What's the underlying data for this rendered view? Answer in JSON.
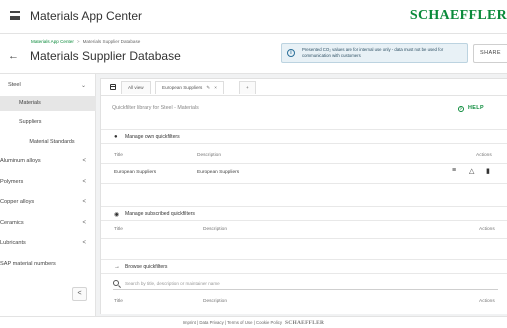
{
  "header": {
    "app_title": "Materials App Center",
    "logo_text": "SCHAEFFLER"
  },
  "subheader": {
    "breadcrumb": [
      "Materials App Center",
      "Materials Supplier Database"
    ],
    "page_title": "Materials Supplier Database",
    "notice": "Presented CO₂ values are for internal use only - data must not be used for communication with customers",
    "share_label": "SHARE"
  },
  "sidebar": {
    "steel": "Steel",
    "steel_sub": [
      "Materials",
      "Suppliers",
      "Material Standards"
    ],
    "groups": [
      "Aluminum alloys",
      "Polymers",
      "Copper alloys",
      "Ceramics",
      "Lubricants"
    ],
    "sap": "SAP material numbers",
    "collapse_icon": "chevron-left"
  },
  "main": {
    "tabs": [
      {
        "label": "All view"
      },
      {
        "label": "European Suppliers"
      },
      {
        "label": "+"
      }
    ],
    "qf_title": "Quickfilter library for Steel - Materials",
    "help_label": "HELP",
    "own": {
      "label": "Manage own quickfilters",
      "col_title": "Title",
      "col_description": "Description",
      "col_actions": "Actions",
      "rows": [
        {
          "title": "European Suppliers",
          "description": "European Suppliers"
        }
      ]
    },
    "subscribed": {
      "label": "Manage subscribed quickfilters",
      "col_title": "Title",
      "col_description": "Description",
      "col_actions": "Actions"
    },
    "browse": {
      "label": "Browse quickfilters",
      "search_placeholder": "Search by title, description or maintainer name",
      "col_title": "Title",
      "col_description": "Description",
      "col_actions": "Actions"
    }
  },
  "footer": {
    "links": "Imprint | Data Privacy | Terms of Use | Cookie Policy",
    "brand": "SCHAEFFLER"
  },
  "colors": {
    "brand_green": "#0a8a3a",
    "notice_bg": "#e8f1f6"
  }
}
